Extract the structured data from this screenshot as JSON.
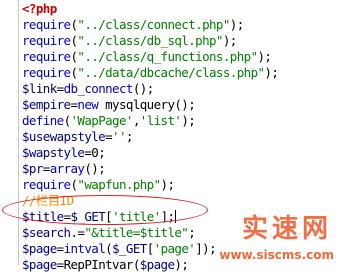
{
  "code": {
    "lines": [
      [
        {
          "c": "tag",
          "t": "<?php"
        }
      ],
      [
        {
          "c": "k",
          "t": "require"
        },
        {
          "c": "p",
          "t": "("
        },
        {
          "c": "s",
          "t": "\"../class/connect.php\""
        },
        {
          "c": "p",
          "t": ");"
        }
      ],
      [
        {
          "c": "k",
          "t": "require"
        },
        {
          "c": "p",
          "t": "("
        },
        {
          "c": "s",
          "t": "\"../class/db_sql.php\""
        },
        {
          "c": "p",
          "t": ");"
        }
      ],
      [
        {
          "c": "k",
          "t": "require"
        },
        {
          "c": "p",
          "t": "("
        },
        {
          "c": "s",
          "t": "\"../class/q_functions.php\""
        },
        {
          "c": "p",
          "t": ");"
        }
      ],
      [
        {
          "c": "k",
          "t": "require"
        },
        {
          "c": "p",
          "t": "("
        },
        {
          "c": "s",
          "t": "\"../data/dbcache/class.php\""
        },
        {
          "c": "p",
          "t": ");"
        }
      ],
      [
        {
          "c": "v",
          "t": "$link"
        },
        {
          "c": "p",
          "t": "="
        },
        {
          "c": "k",
          "t": "db_connect"
        },
        {
          "c": "p",
          "t": "();"
        }
      ],
      [
        {
          "c": "v",
          "t": "$empire"
        },
        {
          "c": "p",
          "t": "="
        },
        {
          "c": "k",
          "t": "new"
        },
        {
          "c": "p",
          "t": " mysqlquery();"
        }
      ],
      [
        {
          "c": "k",
          "t": "define"
        },
        {
          "c": "p",
          "t": "("
        },
        {
          "c": "s",
          "t": "'WapPage'"
        },
        {
          "c": "p",
          "t": ","
        },
        {
          "c": "s",
          "t": "'list'"
        },
        {
          "c": "p",
          "t": ");"
        }
      ],
      [
        {
          "c": "v",
          "t": "$usewapstyle"
        },
        {
          "c": "p",
          "t": "="
        },
        {
          "c": "s",
          "t": "''"
        },
        {
          "c": "p",
          "t": ";"
        }
      ],
      [
        {
          "c": "v",
          "t": "$wapstyle"
        },
        {
          "c": "p",
          "t": "=0;"
        }
      ],
      [
        {
          "c": "v",
          "t": "$pr"
        },
        {
          "c": "p",
          "t": "="
        },
        {
          "c": "k",
          "t": "array"
        },
        {
          "c": "p",
          "t": "();"
        }
      ],
      [
        {
          "c": "k",
          "t": "require"
        },
        {
          "c": "p",
          "t": "("
        },
        {
          "c": "s",
          "t": "\"wapfun.php\""
        },
        {
          "c": "p",
          "t": ");"
        }
      ],
      [
        {
          "c": "c",
          "t": "//栏目ID"
        }
      ],
      [
        {
          "c": "v",
          "t": "$title"
        },
        {
          "c": "p",
          "t": "="
        },
        {
          "c": "v",
          "t": "$_GET"
        },
        {
          "c": "p",
          "t": "["
        },
        {
          "c": "s",
          "t": "'title'"
        },
        {
          "c": "p",
          "t": "];"
        }
      ],
      [
        {
          "c": "v",
          "t": "$search"
        },
        {
          "c": "p",
          "t": ".="
        },
        {
          "c": "s",
          "t": "\"&title=$title\""
        },
        {
          "c": "p",
          "t": ";"
        }
      ],
      [
        {
          "c": "v",
          "t": "$page"
        },
        {
          "c": "p",
          "t": "="
        },
        {
          "c": "k",
          "t": "intval"
        },
        {
          "c": "p",
          "t": "("
        },
        {
          "c": "v",
          "t": "$_GET"
        },
        {
          "c": "p",
          "t": "["
        },
        {
          "c": "s",
          "t": "'page'"
        },
        {
          "c": "p",
          "t": "]);"
        }
      ],
      [
        {
          "c": "v",
          "t": "$page"
        },
        {
          "c": "p",
          "t": "=RepPIntvar("
        },
        {
          "c": "v",
          "t": "$page"
        },
        {
          "c": "p",
          "t": ");"
        }
      ]
    ],
    "cursor_line": 13
  },
  "watermark": {
    "title": "实速网",
    "url": "www.siscms.com"
  }
}
